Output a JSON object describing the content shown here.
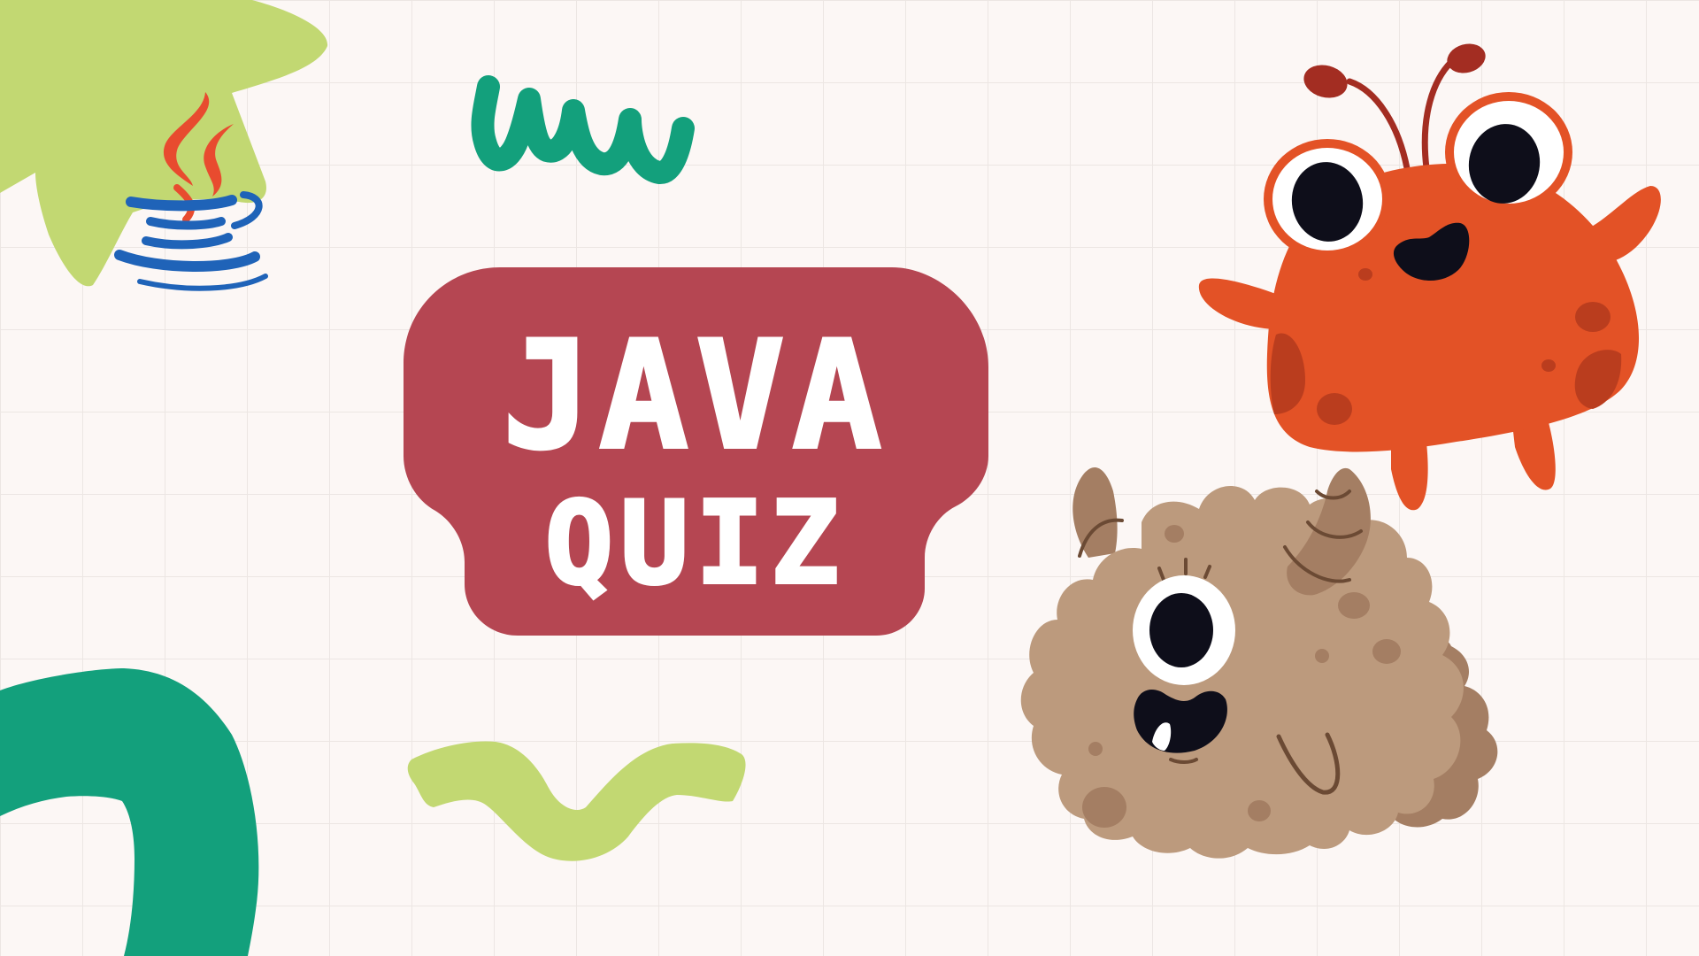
{
  "title": {
    "line1": "JAVA",
    "line2": "QUIZ"
  },
  "colors": {
    "background": "#fcf7f5",
    "grid": "#ece6e3",
    "title_badge": "#b54652",
    "title_text": "#ffffff",
    "lime": "#c2d872",
    "green": "#13a07c",
    "java_red": "#e84b2f",
    "java_blue": "#1f63b8",
    "orange_monster": "#e35226",
    "orange_monster_dark": "#ba3d1e",
    "antenna": "#a32d22",
    "brown_monster": "#bc9a7d",
    "brown_monster_dark": "#a47e63",
    "eye_white": "#ffffff",
    "pupil": "#0e0e1a"
  },
  "icons": {
    "logo": "java-coffee-cup-icon"
  }
}
